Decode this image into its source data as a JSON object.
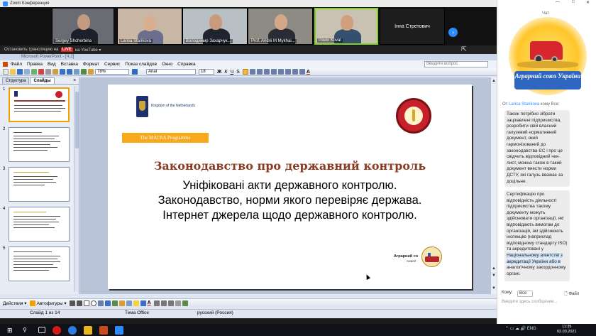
{
  "zoom": {
    "window_title": "Zoom Конференция",
    "participants": [
      {
        "name": "Sergey Shcherbina"
      },
      {
        "name": "Larisa Starikova"
      },
      {
        "name": "Володимир Захарчук..."
      },
      {
        "name": "Prof. Andrii M Mykhai..."
      },
      {
        "name": "Pavlo Koval"
      },
      {
        "name": "Інна Стретович"
      }
    ],
    "next_icon": "chevron-right-icon",
    "youtube_left": "Остановить трансляцию на",
    "live_label": "LIVE",
    "youtube_right": "на YouTube ▾",
    "ppt_window_title": "Microsoft PowerPoint - [Ч.2]"
  },
  "ppt": {
    "menu": [
      "Файл",
      "Правка",
      "Вид",
      "Вставка",
      "Формат",
      "Сервис",
      "Показ слайдов",
      "Окно",
      "Справка"
    ],
    "help_placeholder": "Введите вопрос",
    "zoom_value": "78%",
    "font_name": "Arial",
    "font_size": "18",
    "pane_tabs": [
      "Структура",
      "Слайды"
    ],
    "thumbnails": [
      {
        "num": "1"
      },
      {
        "num": "2"
      },
      {
        "num": "3"
      },
      {
        "num": "4"
      },
      {
        "num": "5"
      }
    ],
    "slide": {
      "nl_text": "Kingdom of the Netherlands",
      "matra": "The MATRA Programme",
      "title": "Законодавство про державний контроль",
      "lines": [
        "Уніфіковані акти державного контролю.",
        "Законодавство, норми якого перевіряє держава.",
        "Інтернет джерела щодо державного контролю."
      ],
      "brand_text": "Аграрний со",
      "brand_sub": "Аналіт"
    },
    "draw_actions_label": "Действия ▾",
    "autoshapes_label": "Автофигуры ▾",
    "status": {
      "slide": "Слайд 1 из 14",
      "theme": "Тема Office",
      "language": "русский (Россия)"
    }
  },
  "chat": {
    "title": "Чат",
    "logo_text": "Аграрний союз України",
    "from_prefix": "От",
    "from_name": "Larisa Starikova",
    "from_suffix": "кому Все:",
    "message1": "Також потрібно зібрати зацікавлені підприємства, розробити свій власний галузевий нормативний документ, який гармонізований до законодавства ЄС і про це свідчить відповідний чек-лист, можна також в такий документ внести норми ДСТУ, які галузь вважає за доцільне.",
    "message2_a": "Сертифікацію про відповідність діяльності підприємства такому документу можуть здійснювати організації, які відповідають вимогам до організацій, які здійснюють інспекцію (наприклад відповідному стандарту ISO) та акредитовані у ",
    "message2_hl": "Національному агентстві з акредитації України або в",
    "message2_b": " аналогічному закордонному органі.",
    "to_label": "Кому:",
    "to_value": "Все",
    "file_label": "Файл",
    "input_placeholder": "Введите здесь сообщение..."
  },
  "taskbar": {
    "tray_lang": "ENG",
    "time": "11:35",
    "date": "02.03.2021"
  }
}
